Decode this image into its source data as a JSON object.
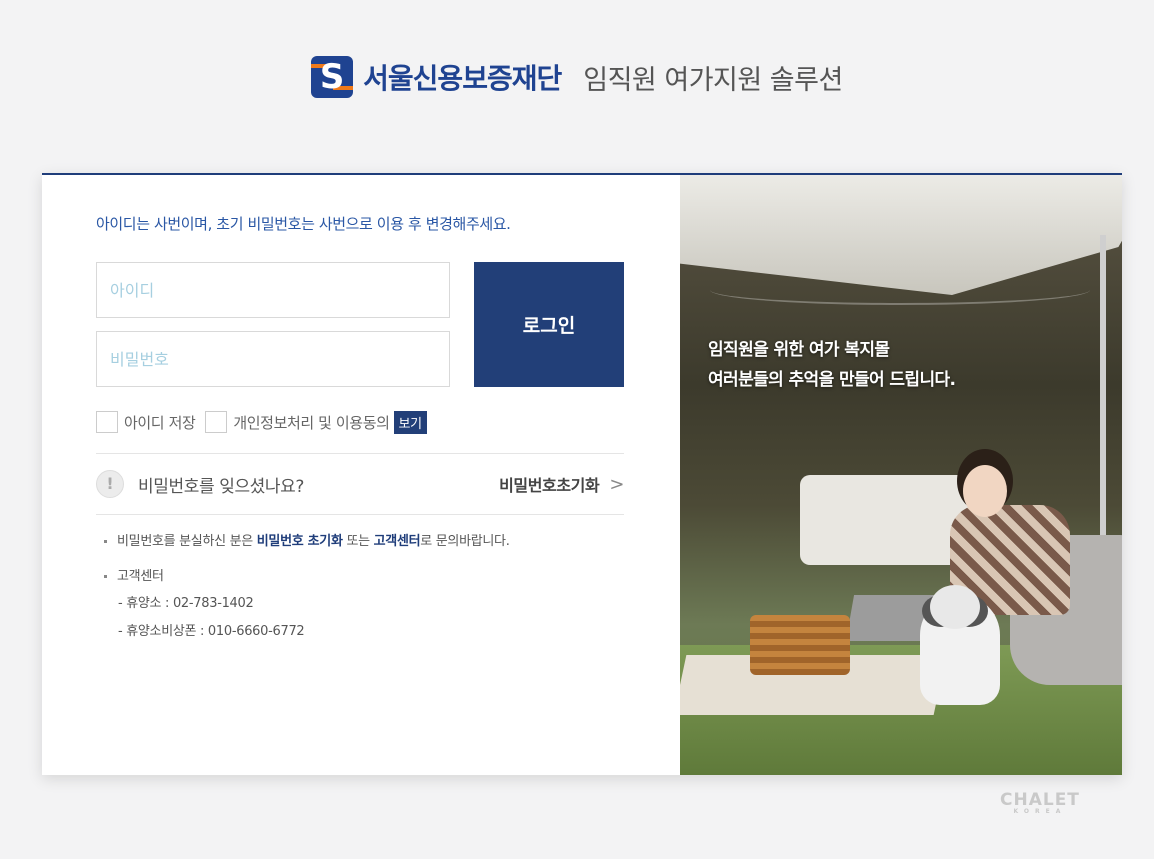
{
  "header": {
    "org_name": "서울신용보증재단",
    "subtitle": "임직원 여가지원 솔루션",
    "logo_letter": "S"
  },
  "login": {
    "notice": "아이디는 사번이며, 초기 비밀번호는 사번으로 이용 후 변경해주세요.",
    "id_placeholder": "아이디",
    "password_placeholder": "비밀번호",
    "login_button": "로그인",
    "remember_id_label": "아이디 저장",
    "privacy_consent_label": "개인정보처리 및 이용동의",
    "view_badge": "보기"
  },
  "forgot": {
    "question": "비밀번호를 잊으셨나요?",
    "reset_link": "비밀번호초기화",
    "warn_icon": "exclamation-icon"
  },
  "info": {
    "line1_prefix": "비밀번호를 분실하신 분은 ",
    "line1_bold1": "비밀번호 초기화",
    "line1_mid": " 또는 ",
    "line1_bold2": "고객센터",
    "line1_suffix": "로 문의바랍니다.",
    "support_title": "고객센터",
    "resort_phone": "- 휴양소 : 02-783-1402",
    "resort_mobile": "- 휴양소비상폰 : 010-6660-6772"
  },
  "banner": {
    "slogan_line1": "임직원을 위한 여가 복지몰",
    "slogan_line2": "여러분들의 추억을 만들어 드립니다."
  },
  "watermark": {
    "brand": "CHALET",
    "sub": "KOREA"
  },
  "colors": {
    "primary": "#223f78",
    "link_blue": "#2a57a5",
    "accent_orange": "#f07a1a"
  }
}
